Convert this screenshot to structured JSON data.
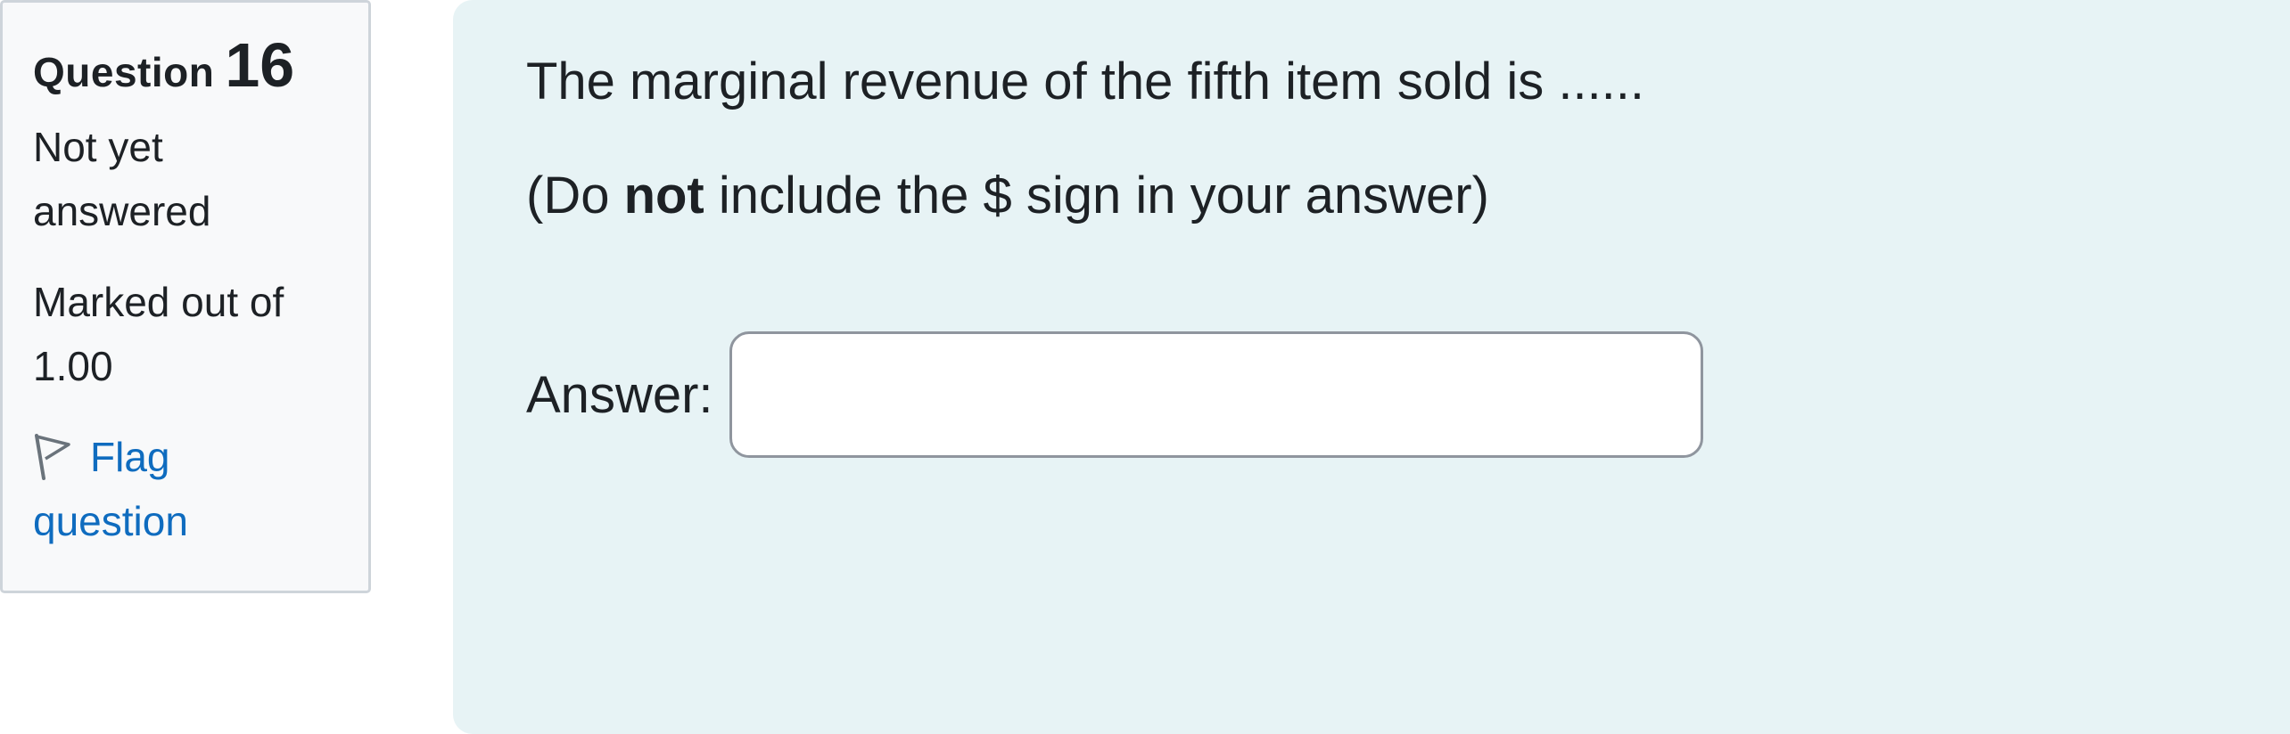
{
  "info": {
    "question_word": "Question",
    "question_number": "16",
    "state": "Not yet answered",
    "state_line1": "Not yet",
    "state_line2": "answered",
    "grade_line1": "Marked out of",
    "grade_line2": "1.00",
    "flag_line1": "Flag",
    "flag_line2": "question",
    "flag_icon": "flag-outline-icon"
  },
  "question": {
    "text": "The marginal revenue of the fifth item sold is ......",
    "note_prefix": "(Do ",
    "note_bold": "not",
    "note_suffix": " include the $ sign in your answer)"
  },
  "answer": {
    "label": "Answer:",
    "value": "",
    "placeholder": ""
  },
  "colors": {
    "link": "#0f6cbf",
    "content_bg": "#e7f3f5",
    "info_bg": "#f8f9fa"
  }
}
